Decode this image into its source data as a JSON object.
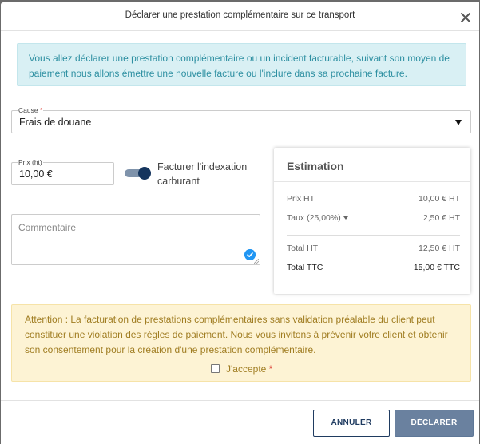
{
  "modal": {
    "title": "Déclarer une prestation complémentaire sur ce transport"
  },
  "info": {
    "text": "Vous allez déclarer une prestation complémentaire ou un incident facturable, suivant son moyen de paiement nous allons émettre une nouvelle facture ou l'inclure dans sa prochaine facture."
  },
  "form": {
    "cause_label": "Cause",
    "cause_required": "*",
    "cause_value": "Frais de douane",
    "prix_label": "Prix (ht)",
    "prix_value": "10,00 €",
    "toggle_label": "Facturer l'indexation carburant",
    "toggle_on": true,
    "comment_placeholder": "Commentaire"
  },
  "estimation": {
    "title": "Estimation",
    "prix_ht_label": "Prix HT",
    "prix_ht_value": "10,00 € HT",
    "taux_label": "Taux (25,00%)",
    "taux_value": "2,50 € HT",
    "total_ht_label": "Total HT",
    "total_ht_value": "12,50 € HT",
    "total_ttc_label": "Total TTC",
    "total_ttc_value": "15,00 € TTC"
  },
  "warning": {
    "text": "Attention : La facturation de prestations complémentaires sans validation préalable du client peut constituer une violation des règles de paiement. Nous vous invitons à prévenir votre client et obtenir son consentement pour la création d'une prestation complémentaire.",
    "accept_label": "J'accepte",
    "accept_required": "*"
  },
  "footer": {
    "cancel_label": "ANNULER",
    "submit_label": "DÉCLARER"
  },
  "icons": {
    "close": "close-icon",
    "dropdown": "caret-down-icon",
    "check": "check-circle-icon"
  },
  "colors": {
    "info_bg": "#d9f0f4",
    "info_text": "#2d8fa1",
    "warning_bg": "#fdf3d4",
    "warning_text": "#a07d22",
    "toggle_knob": "#15355e",
    "primary_button": "#6a819f",
    "required": "#d9342b"
  }
}
